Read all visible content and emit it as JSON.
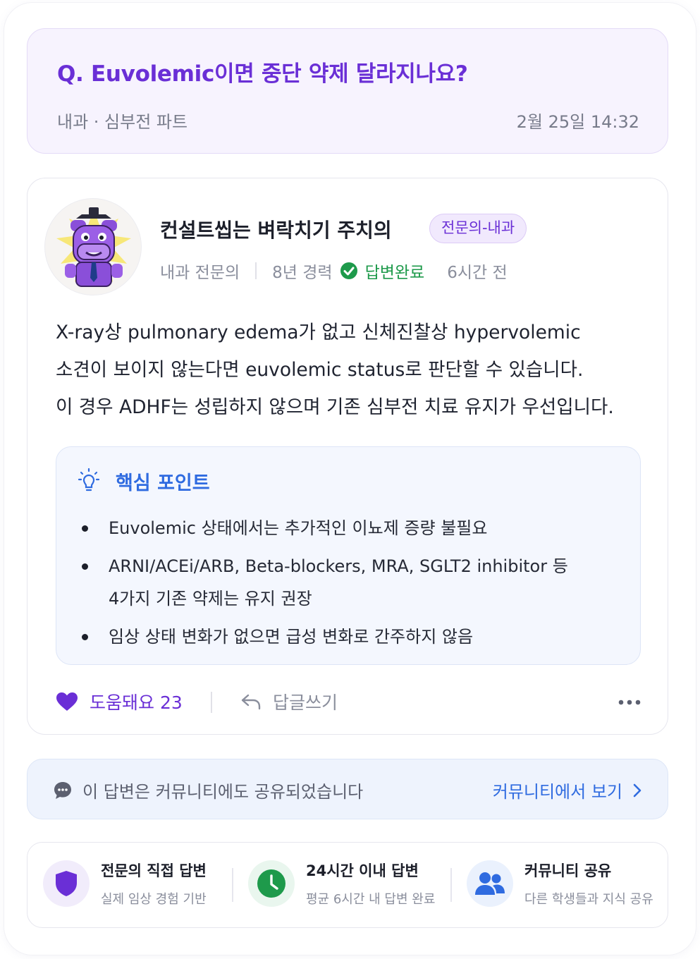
{
  "question": {
    "title": "Q. Euvolemic이면 중단 약제 달라지나요?",
    "category": "내과 · 심부전 파트",
    "datetime": "2월 25일 14:32"
  },
  "answer": {
    "author_name": "컨설트씹는 벼락치기 주치의",
    "badge": "전문의-내과",
    "specialty": "내과 전문의",
    "experience": "8년 경력",
    "status": "답변완료",
    "time_ago": "6시간 전",
    "body_lines": [
      "X-ray상 pulmonary edema가 없고 신체진찰상 hypervolemic",
      "소견이 보이지 않는다면 euvolemic status로 판단할 수 있습니다.",
      "이 경우 ADHF는 성립하지 않으며 기존 심부전 치료 유지가 우선입니다."
    ],
    "key_points": {
      "title": "핵심 포인트",
      "items": [
        [
          "Euvolemic 상태에서는 추가적인 이뇨제 증량 불필요"
        ],
        [
          "ARNI/ACEi/ARB, Beta-blockers, MRA, SGLT2 inhibitor 등",
          "4가지 기존 약제는 유지 권장"
        ],
        [
          "임상 상태 변화가 없으면 급성 변화로 간주하지 않음"
        ]
      ]
    },
    "actions": {
      "like_label": "도움돼요 23",
      "reply_label": "답글쓰기"
    }
  },
  "share_banner": {
    "text": "이 답변은 커뮤니티에도 공유되었습니다",
    "link": "커뮤니티에서 보기"
  },
  "features": [
    {
      "title": "전문의 직접 답변",
      "subtitle": "실제 임상 경험 기반",
      "icon": "shield-icon",
      "color": "#6a2fd6"
    },
    {
      "title": "24시간 이내 답변",
      "subtitle": "평균 6시간 내 답변 완료",
      "icon": "clock-icon",
      "color": "#1e9a4b"
    },
    {
      "title": "커뮤니티 공유",
      "subtitle": "다른 학생들과 지식 공유",
      "icon": "users-icon",
      "color": "#2f6be0"
    }
  ],
  "colors": {
    "purple": "#6a2fd6",
    "green": "#1e9a4b",
    "blue": "#2f6be0"
  }
}
